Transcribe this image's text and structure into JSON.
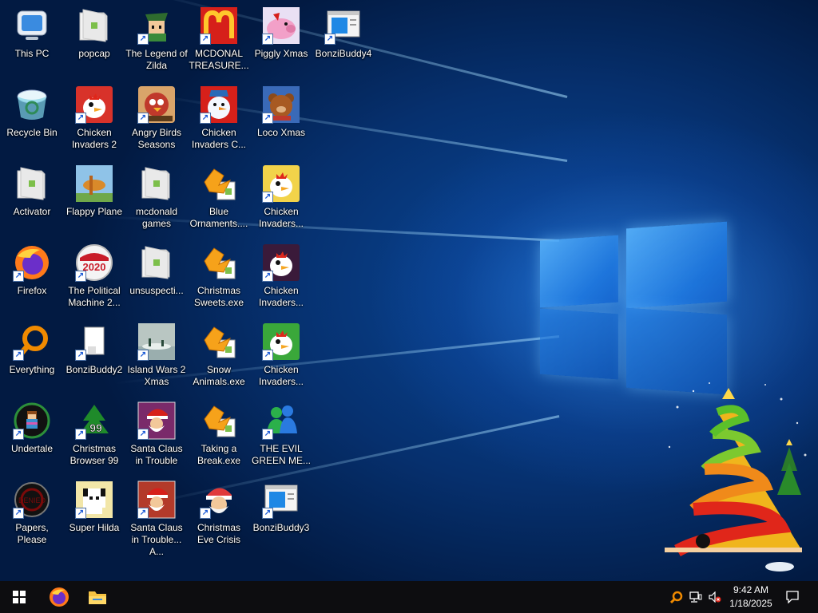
{
  "desktop": {
    "icons": [
      {
        "id": "this-pc",
        "label": "This PC",
        "icon": "computer-icon",
        "color": "#3a8be0",
        "shortcut": false
      },
      {
        "id": "recycle-bin",
        "label": "Recycle Bin",
        "icon": "recycle-bin-icon",
        "color": "#7fd3e6",
        "shortcut": false
      },
      {
        "id": "activator",
        "label": "Activator",
        "icon": "folder-icon",
        "color": "#e9e9e9",
        "shortcut": false
      },
      {
        "id": "firefox",
        "label": "Firefox",
        "icon": "firefox-icon",
        "color": "#ff7a1a",
        "shortcut": true
      },
      {
        "id": "everything",
        "label": "Everything",
        "icon": "magnifier-icon",
        "color": "#f08a00",
        "shortcut": true
      },
      {
        "id": "undertale",
        "label": "Undertale",
        "icon": "undertale-icon",
        "color": "#2c8f3a",
        "shortcut": true
      },
      {
        "id": "papers-please",
        "label": "Papers, Please",
        "icon": "papers-please-icon",
        "color": "#7a0a0a",
        "shortcut": true
      },
      {
        "id": "popcap",
        "label": "popcap",
        "icon": "folder-icon",
        "color": "#e9e9e9",
        "shortcut": false
      },
      {
        "id": "chicken-invaders-2",
        "label": "Chicken Invaders 2",
        "icon": "chicken-icon",
        "color": "#d8322a",
        "shortcut": true
      },
      {
        "id": "flappy-plane",
        "label": "Flappy Plane",
        "icon": "flappy-plane-icon",
        "color": "#8fc3e8",
        "shortcut": false
      },
      {
        "id": "political-machine",
        "label": "The Political Machine 2...",
        "icon": "political-machine-icon",
        "color": "#c91d2a",
        "shortcut": true
      },
      {
        "id": "bonzibuddy2",
        "label": "BonziBuddy2",
        "icon": "blank-document-icon",
        "color": "#ffffff",
        "shortcut": true
      },
      {
        "id": "christmas-browser-99",
        "label": "Christmas Browser 99",
        "icon": "christmas-tree-icon",
        "color": "#1f8a2a",
        "shortcut": true
      },
      {
        "id": "super-hilda",
        "label": "Super Hilda",
        "icon": "pixel-dog-icon",
        "color": "#f2e6a8",
        "shortcut": true
      },
      {
        "id": "legend-of-zilda",
        "label": "The Legend of Zilda",
        "icon": "zilda-icon",
        "color": "#2e6b2e",
        "shortcut": true
      },
      {
        "id": "angry-birds-seasons",
        "label": "Angry Birds Seasons",
        "icon": "angry-birds-icon",
        "color": "#c0392b",
        "shortcut": true
      },
      {
        "id": "mcdonald-games",
        "label": "mcdonald games",
        "icon": "folder-icon",
        "color": "#e9e9e9",
        "shortcut": false
      },
      {
        "id": "unsuspecti",
        "label": "unsuspecti...",
        "icon": "folder-icon",
        "color": "#e9e9e9",
        "shortcut": false
      },
      {
        "id": "island-wars-2-xmas",
        "label": "Island Wars 2 Xmas",
        "icon": "island-wars-icon",
        "color": "#b9c6c2",
        "shortcut": true
      },
      {
        "id": "santa-claus-in-trouble",
        "label": "Santa Claus in Trouble",
        "icon": "santa-icon",
        "color": "#7a2a6a",
        "shortcut": true
      },
      {
        "id": "santa-claus-in-trouble-a",
        "label": "Santa Claus in Trouble... A...",
        "icon": "santa-icon",
        "color": "#b33a2a",
        "shortcut": true
      },
      {
        "id": "mcdonal-treasure",
        "label": "MCDONAL TREASURE...",
        "icon": "mcdonalds-icon",
        "color": "#d6201a",
        "shortcut": true
      },
      {
        "id": "chicken-invaders-c",
        "label": "Chicken Invaders C...",
        "icon": "snowman-icon",
        "color": "#d6201a",
        "shortcut": true
      },
      {
        "id": "blue-ornaments",
        "label": "Blue Ornaments....",
        "icon": "installer-icon",
        "color": "#f6a21a",
        "shortcut": false
      },
      {
        "id": "christmas-sweets",
        "label": "Christmas Sweets.exe",
        "icon": "installer-icon",
        "color": "#f6a21a",
        "shortcut": false
      },
      {
        "id": "snow-animals",
        "label": "Snow Animals.exe",
        "icon": "installer-icon",
        "color": "#f6a21a",
        "shortcut": false
      },
      {
        "id": "taking-a-break",
        "label": "Taking a Break.exe",
        "icon": "installer-icon",
        "color": "#f6a21a",
        "shortcut": false
      },
      {
        "id": "christmas-eve-crisis",
        "label": "Christmas Eve Crisis",
        "icon": "santa-face-icon",
        "color": "#e03a3a",
        "shortcut": true
      },
      {
        "id": "piggly-xmas",
        "label": "Piggly Xmas",
        "icon": "pig-icon",
        "color": "#f2a0c8",
        "shortcut": true
      },
      {
        "id": "loco-xmas",
        "label": "Loco Xmas",
        "icon": "teddy-bear-icon",
        "color": "#3a6ab8",
        "shortcut": true
      },
      {
        "id": "chicken-invaders-3",
        "label": "Chicken Invaders...",
        "icon": "chicken-icon",
        "color": "#f2d34a",
        "shortcut": true
      },
      {
        "id": "chicken-invaders-4",
        "label": "Chicken Invaders...",
        "icon": "chicken-icon",
        "color": "#3a1a3a",
        "shortcut": true
      },
      {
        "id": "chicken-invaders-5",
        "label": "Chicken Invaders...",
        "icon": "chicken-icon",
        "color": "#3aa83a",
        "shortcut": true
      },
      {
        "id": "the-evil-green-me",
        "label": "THE EVIL GREEN ME...",
        "icon": "messenger-icon",
        "color": "#2bb04a",
        "shortcut": true
      },
      {
        "id": "bonzibuddy3",
        "label": "BonziBuddy3",
        "icon": "window-app-icon",
        "color": "#1e88e5",
        "shortcut": true
      },
      {
        "id": "bonzibuddy4",
        "label": "BonziBuddy4",
        "icon": "window-app-icon",
        "color": "#1e88e5",
        "shortcut": true
      }
    ]
  },
  "taskbar": {
    "start_icon": "windows-logo-icon",
    "pinned": [
      {
        "name": "firefox-icon",
        "color": "#ff7a1a"
      },
      {
        "name": "file-explorer-icon",
        "color": "#f5c242"
      }
    ],
    "tray": [
      {
        "name": "search-tray-icon",
        "color": "#f08a00"
      },
      {
        "name": "network-icon",
        "color": "#ffffff"
      },
      {
        "name": "volume-muted-icon",
        "color": "#ffffff"
      }
    ],
    "clock": {
      "time": "9:42 AM",
      "date": "1/18/2025"
    },
    "notification_icon": "action-center-icon"
  },
  "colors": {
    "accent": "#1e78e0",
    "taskbar": "#0d0d10",
    "wallpaper": "#06306e"
  }
}
